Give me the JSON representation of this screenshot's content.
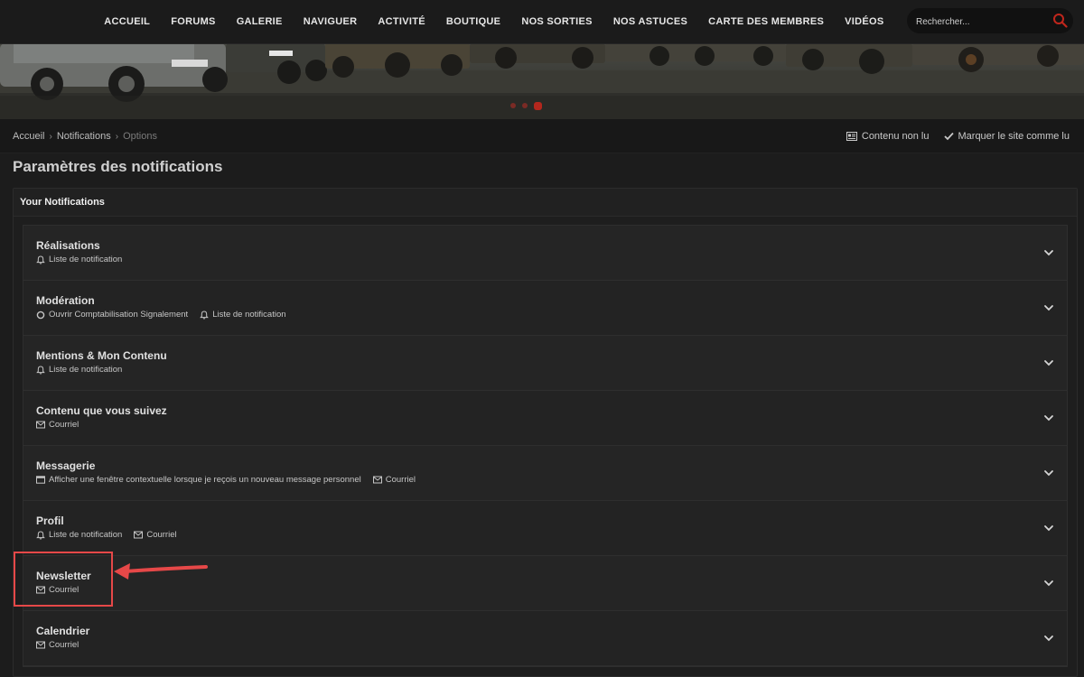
{
  "nav": {
    "items": [
      "ACCUEIL",
      "FORUMS",
      "GALERIE",
      "NAVIGUER",
      "ACTIVITÉ",
      "BOUTIQUE",
      "NOS SORTIES",
      "NOS ASTUCES",
      "CARTE DES MEMBRES",
      "VIDÉOS"
    ],
    "search_placeholder": "Rechercher..."
  },
  "breadcrumb": {
    "items": [
      "Accueil",
      "Notifications",
      "Options"
    ],
    "actions": [
      "Contenu non lu",
      "Marquer le site comme lu"
    ]
  },
  "page": {
    "title": "Paramètres des notifications"
  },
  "panel": {
    "header": "Your Notifications",
    "rows": [
      {
        "title": "Réalisations",
        "meta": [
          {
            "icon": "bell-icon",
            "text": "Liste de notification"
          }
        ]
      },
      {
        "title": "Modération",
        "meta": [
          {
            "icon": "circle-icon",
            "text": "Ouvrir Comptabilisation Signalement"
          },
          {
            "icon": "bell-icon",
            "text": "Liste de notification"
          }
        ]
      },
      {
        "title": "Mentions & Mon Contenu",
        "meta": [
          {
            "icon": "bell-icon",
            "text": "Liste de notification"
          }
        ]
      },
      {
        "title": "Contenu que vous suivez",
        "meta": [
          {
            "icon": "envelope-icon",
            "text": "Courriel"
          }
        ]
      },
      {
        "title": "Messagerie",
        "meta": [
          {
            "icon": "window-icon",
            "text": "Afficher une fenêtre contextuelle lorsque je reçois un nouveau message personnel"
          },
          {
            "icon": "envelope-icon",
            "text": "Courriel"
          }
        ]
      },
      {
        "title": "Profil",
        "meta": [
          {
            "icon": "bell-icon",
            "text": "Liste de notification"
          },
          {
            "icon": "envelope-icon",
            "text": "Courriel"
          }
        ]
      },
      {
        "title": "Newsletter",
        "meta": [
          {
            "icon": "envelope-icon",
            "text": "Courriel"
          }
        ]
      },
      {
        "title": "Calendrier",
        "meta": [
          {
            "icon": "envelope-icon",
            "text": "Courriel"
          }
        ]
      }
    ]
  },
  "colors": {
    "accent": "#c0261c",
    "annotation": "#e64848"
  }
}
